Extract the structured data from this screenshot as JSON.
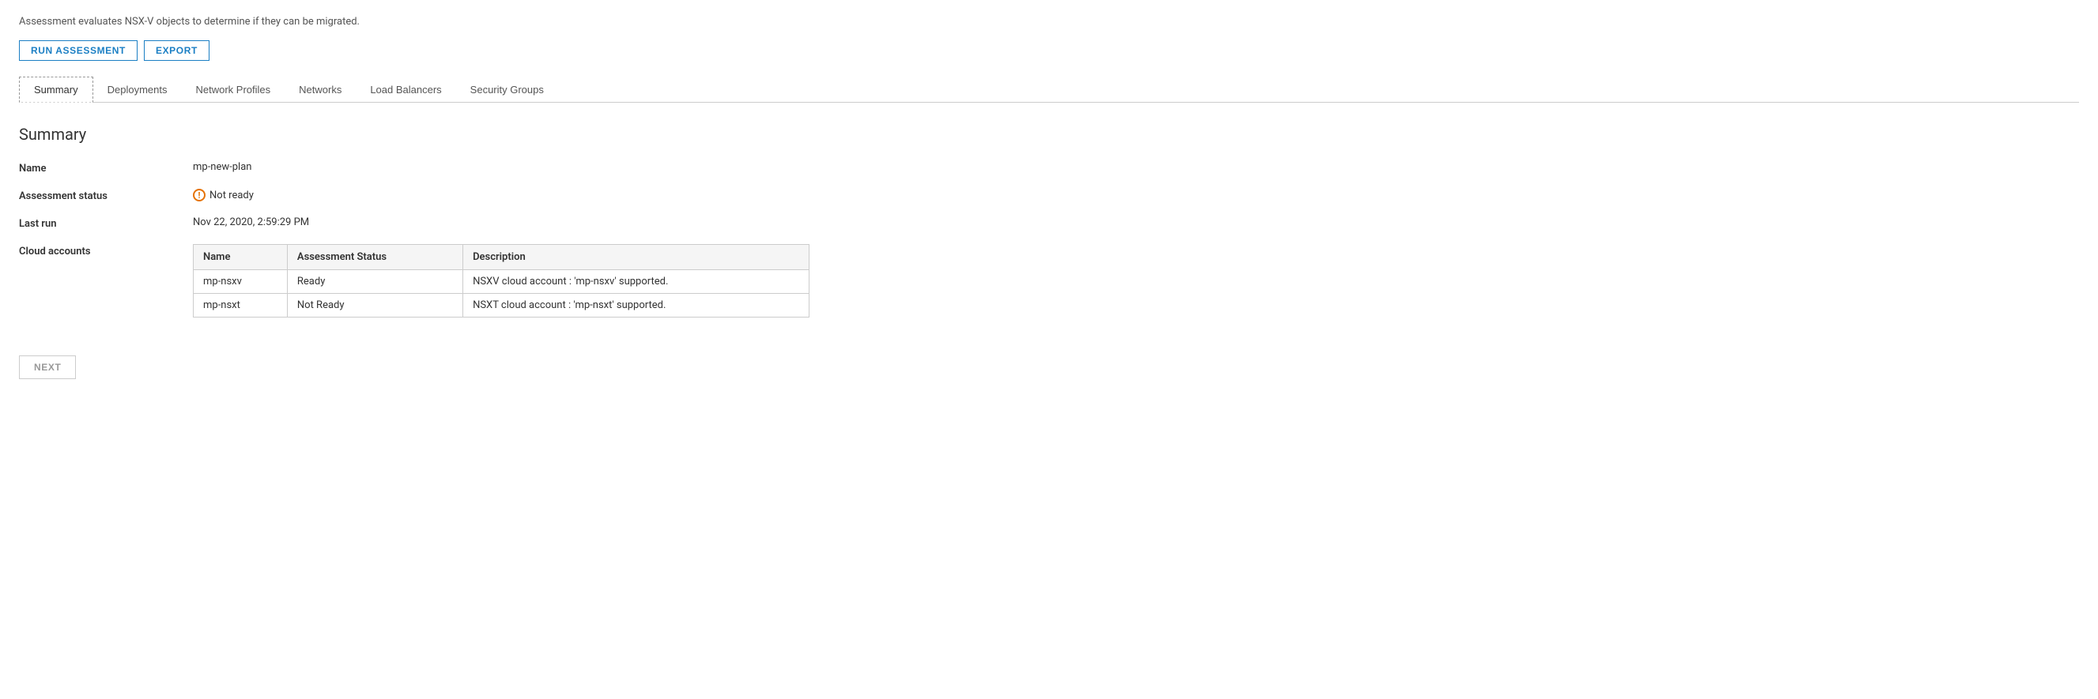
{
  "description": "Assessment evaluates NSX-V objects to determine if they can be migrated.",
  "toolbar": {
    "run_assessment_label": "RUN ASSESSMENT",
    "export_label": "EXPORT"
  },
  "tabs": [
    {
      "label": "Summary",
      "active": true
    },
    {
      "label": "Deployments",
      "active": false
    },
    {
      "label": "Network Profiles",
      "active": false
    },
    {
      "label": "Networks",
      "active": false
    },
    {
      "label": "Load Balancers",
      "active": false
    },
    {
      "label": "Security Groups",
      "active": false
    }
  ],
  "summary": {
    "title": "Summary",
    "fields": {
      "name_label": "Name",
      "name_value": "mp-new-plan",
      "status_label": "Assessment status",
      "status_text": "Not ready",
      "last_run_label": "Last run",
      "last_run_value": "Nov 22, 2020, 2:59:29 PM",
      "cloud_accounts_label": "Cloud accounts"
    },
    "table": {
      "columns": [
        "Name",
        "Assessment Status",
        "Description"
      ],
      "rows": [
        {
          "name": "mp-nsxv",
          "status": "Ready",
          "description": "NSXV cloud account : 'mp-nsxv' supported."
        },
        {
          "name": "mp-nsxt",
          "status": "Not Ready",
          "description": "NSXT cloud account : 'mp-nsxt' supported."
        }
      ]
    }
  },
  "next_button_label": "NEXT"
}
